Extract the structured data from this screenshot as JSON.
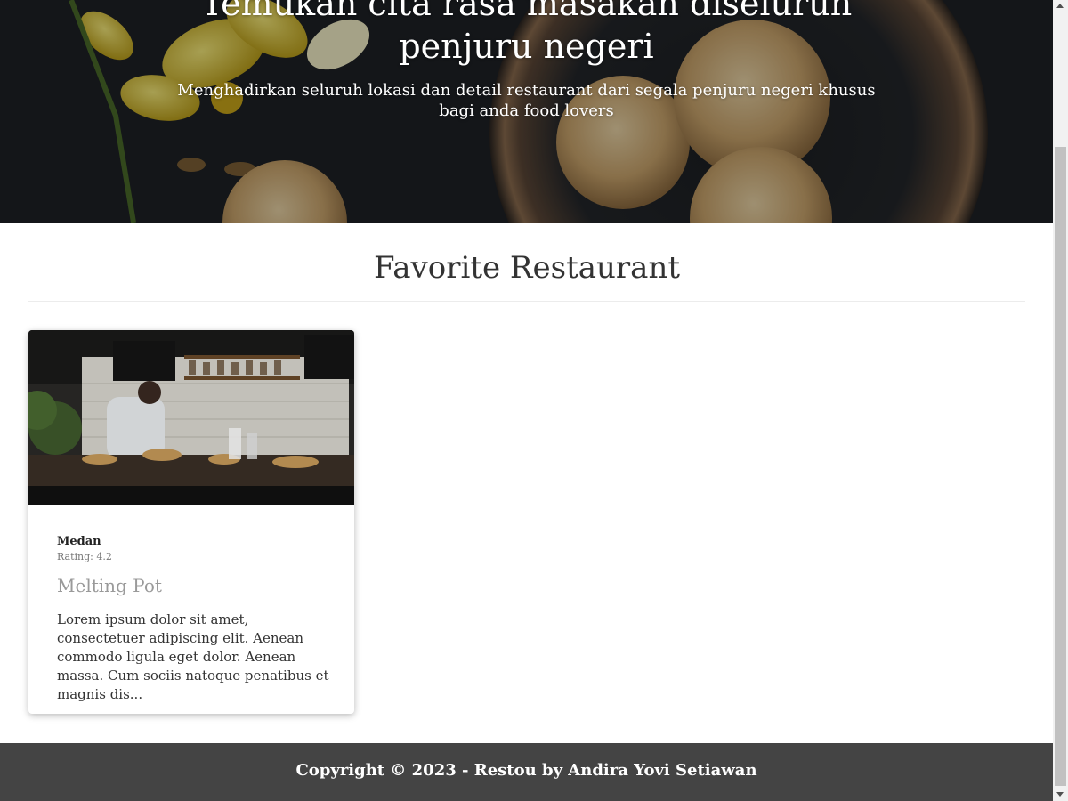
{
  "hero": {
    "title_line1": "Temukan cita rasa masakan diseluruh",
    "title_line2": "penjuru negeri",
    "subtitle": "Menghadirkan seluruh lokasi dan detail restaurant dari segala penjuru negeri khusus bagi anda food lovers"
  },
  "main": {
    "section_title": "Favorite Restaurant",
    "restaurants": [
      {
        "city": "Medan",
        "rating": "Rating: 4.2",
        "name": "Melting Pot",
        "description": "Lorem ipsum dolor sit amet, consectetuer adipiscing elit. Aenean commodo ligula eget dolor. Aenean massa. Cum sociis natoque penatibus et magnis dis..."
      }
    ]
  },
  "footer": {
    "text": "Copyright © 2023 - Restou by Andira Yovi Setiawan"
  },
  "colors": {
    "footer_bg": "#444444",
    "hero_bg": "#1c1f22",
    "restaurant_name": "#9a9a9a"
  }
}
